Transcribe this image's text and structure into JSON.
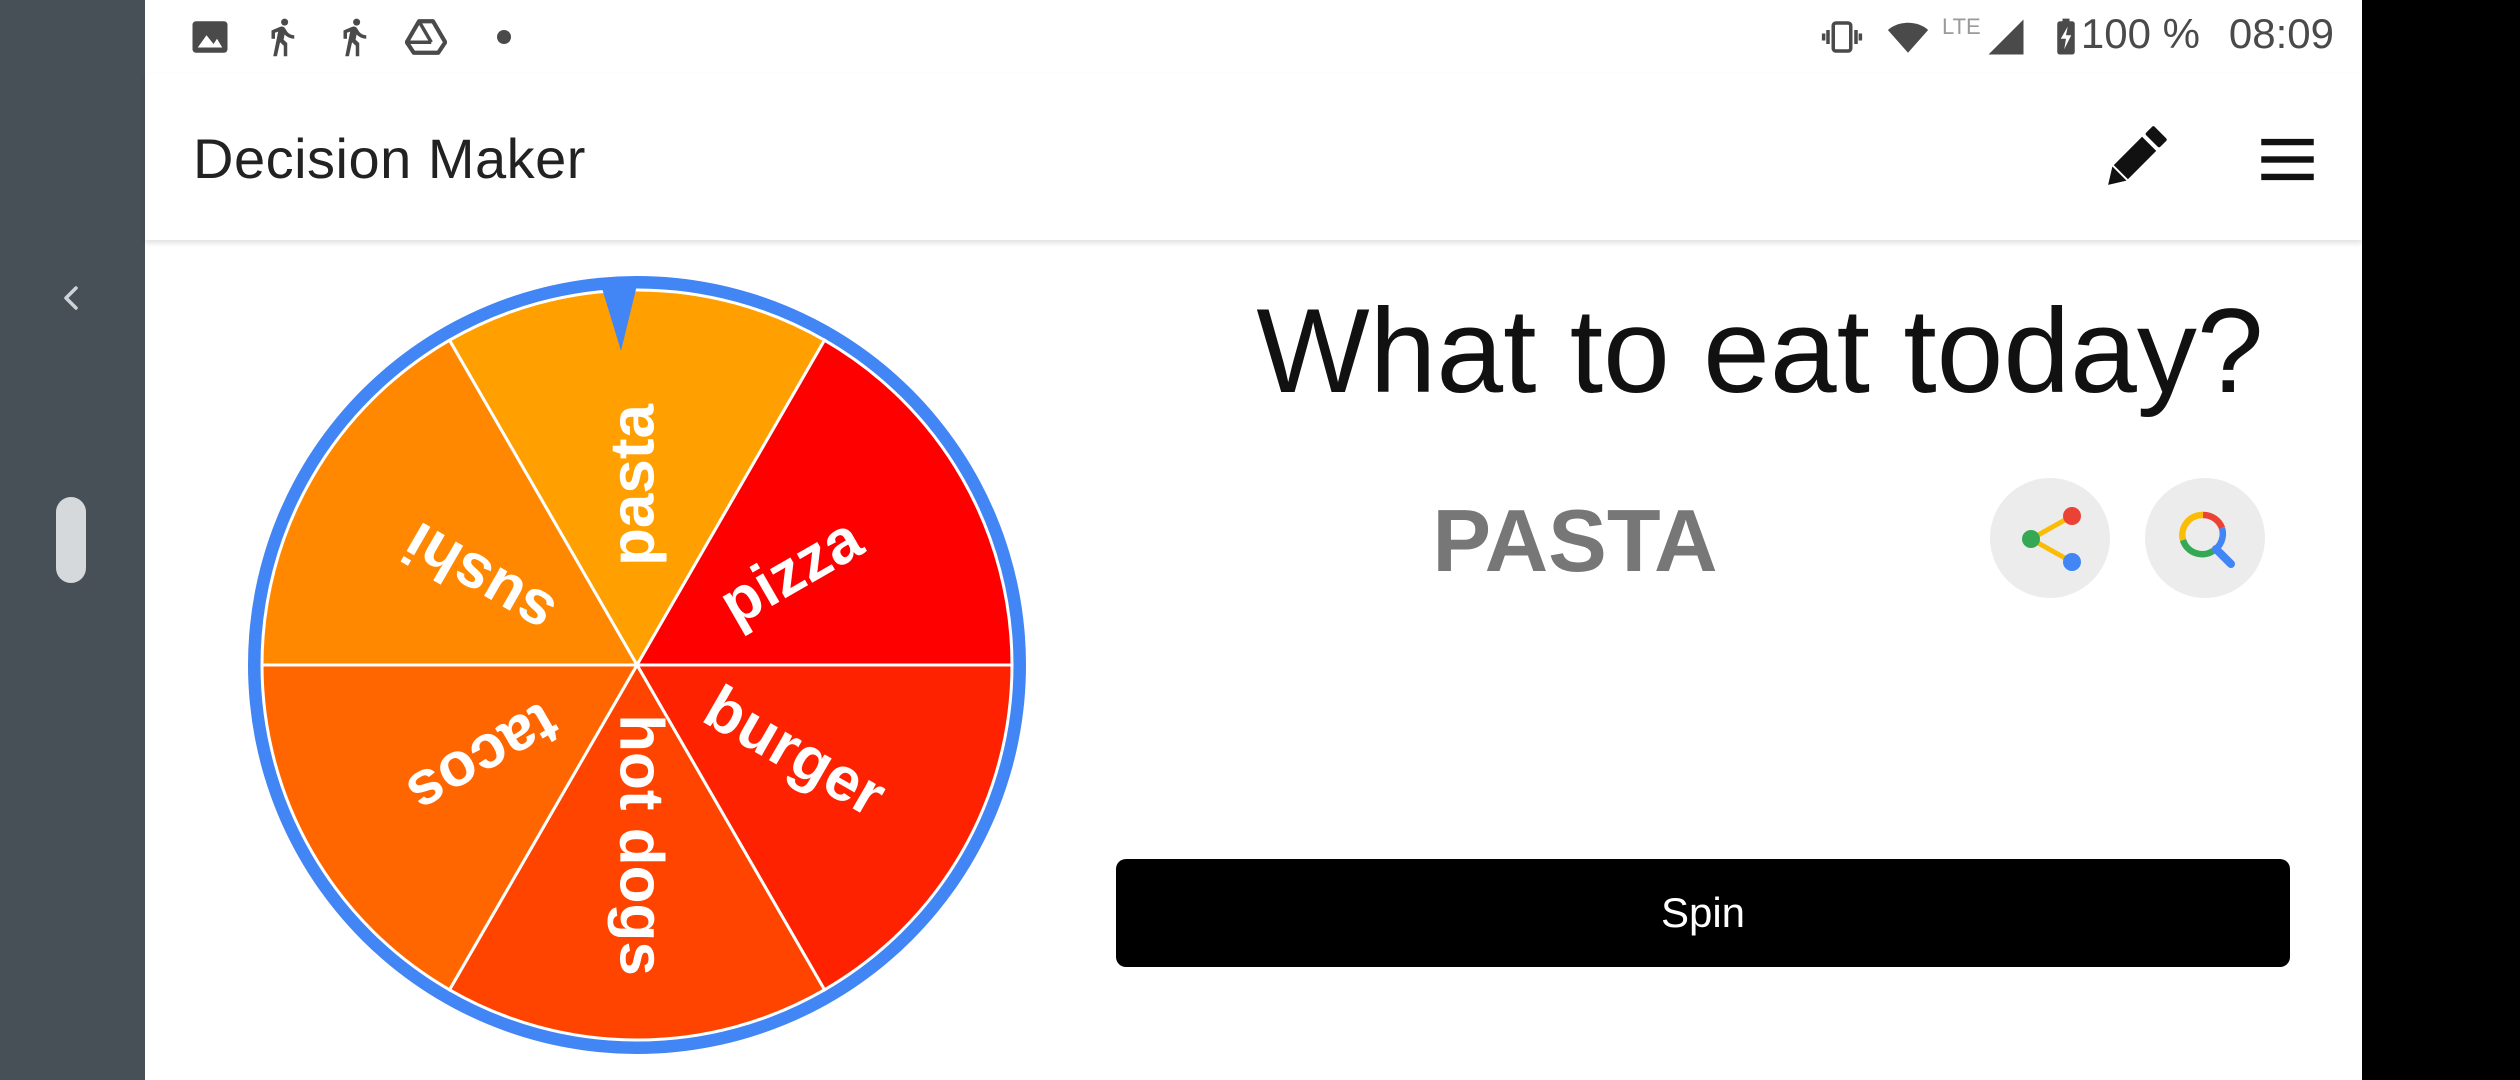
{
  "status_bar": {
    "network": "LTE",
    "battery": "100 %",
    "time": "08:09",
    "notification_icons": [
      "image-icon",
      "walk-icon",
      "walk-icon",
      "drive-icon",
      "dot-icon"
    ]
  },
  "app": {
    "title": "Decision Maker"
  },
  "wheel": {
    "segments": [
      {
        "label": "pasta",
        "color": "#ffa000"
      },
      {
        "label": "pizza",
        "color": "#ff0000"
      },
      {
        "label": "burger",
        "color": "#ff2200"
      },
      {
        "label": "hot dogs",
        "color": "#ff4400"
      },
      {
        "label": "tacos",
        "color": "#ff6600"
      },
      {
        "label": "sushi",
        "color": "#ff8800"
      }
    ],
    "rim_color": "#4285f4"
  },
  "main": {
    "question": "What to eat today?",
    "result": "PASTA",
    "spin_label": "Spin"
  }
}
